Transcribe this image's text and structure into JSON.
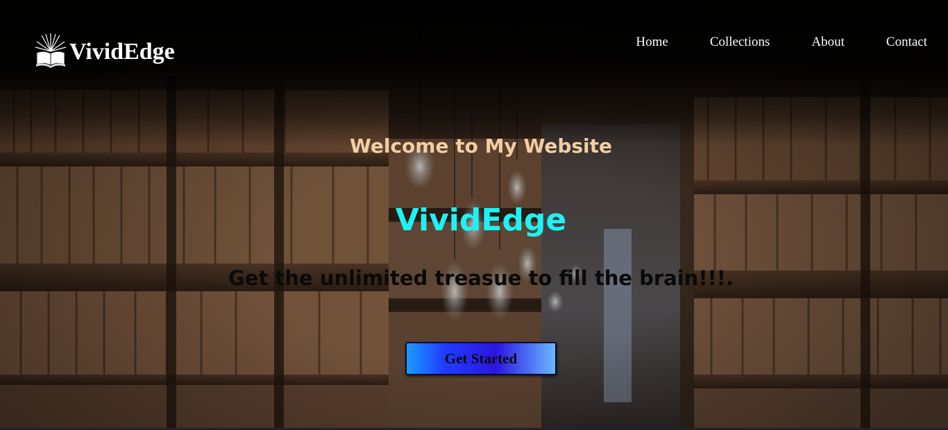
{
  "brand": {
    "name": "VividEdge",
    "icon": "open-book-icon"
  },
  "nav": {
    "items": [
      {
        "label": "Home"
      },
      {
        "label": "Collections"
      },
      {
        "label": "About"
      },
      {
        "label": "Contact"
      }
    ]
  },
  "hero": {
    "welcome": "Welcome to My Website",
    "headline": "VividEdge",
    "tagline": "Get the unlimited treasue to fill the brain!!!.",
    "cta_label": "Get Started",
    "background": "library-bookshelves-image"
  },
  "colors": {
    "welcome": "#f2cfa2",
    "headline": "#1cf3f5",
    "cta_start": "#1a9cff",
    "cta_end": "#6ab8ff"
  }
}
